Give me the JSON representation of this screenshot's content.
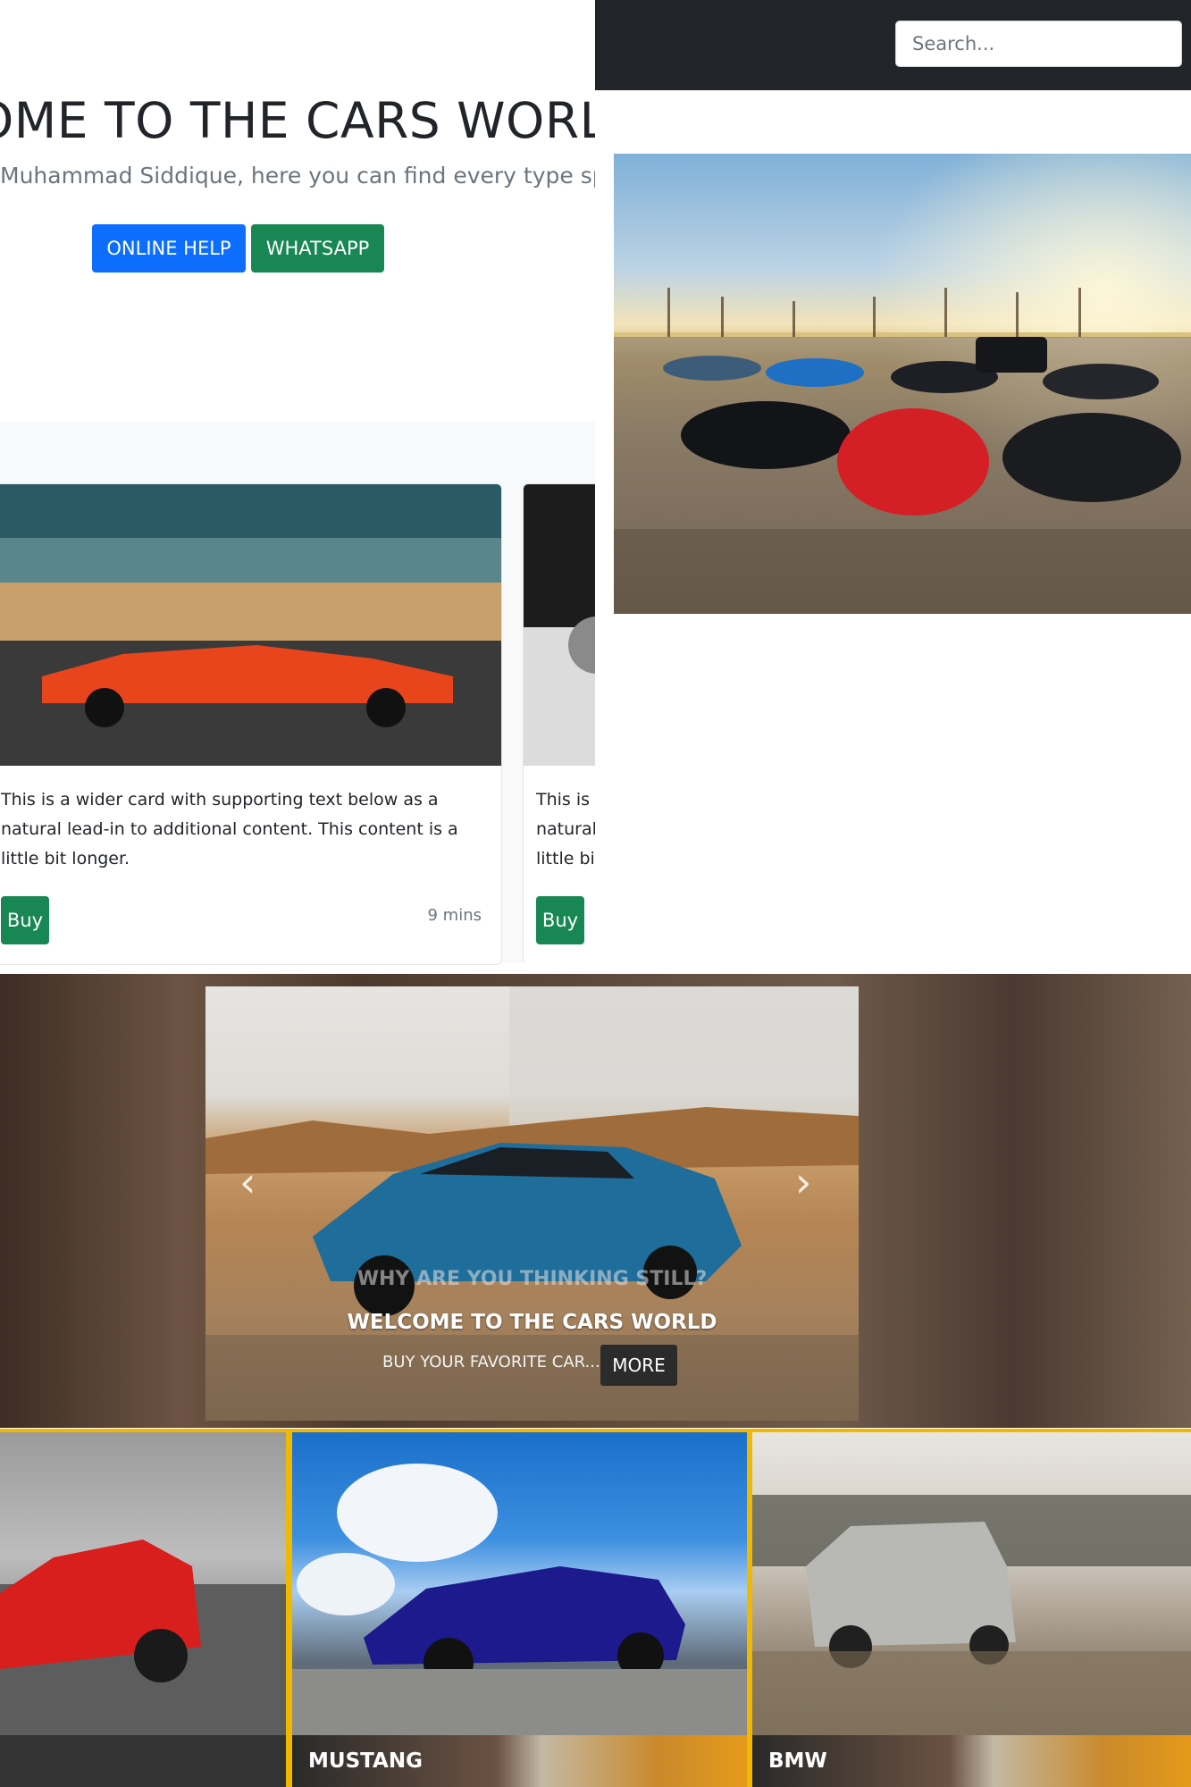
{
  "search": {
    "placeholder": "Search..."
  },
  "hero": {
    "title": "OME TO THE CARS WORLD",
    "subtitle": "Muhammad Siddique, here you can find every type sport",
    "online_help": "ONLINE HELP",
    "whatsapp": "WHATSAPP"
  },
  "cards": [
    {
      "text": "This is a wider card with supporting text below as a natural lead-in to additional content. This content is a little bit longer.",
      "buy": "Buy",
      "time": "9 mins"
    },
    {
      "text": "This is a wider card with supporting text below as a natural lead-in to additional content. This content is a little bit longer.",
      "buy": "Buy",
      "time": ""
    }
  ],
  "carousel": {
    "tagline": "WHY ARE YOU THINKING STILL?",
    "title": "WELCOME TO THE CARS WORLD",
    "subtitle": "BUY YOUR FAVORITE CAR.....",
    "more": "MORE",
    "prev_icon": "chevron-left-icon",
    "next_icon": "chevron-right-icon"
  },
  "gallery": [
    {
      "label": ""
    },
    {
      "label": "MUSTANG"
    },
    {
      "label": "BMW"
    }
  ],
  "colors": {
    "navbar": "#212529",
    "primary": "#0d6efd",
    "success": "#198754",
    "gallery_border": "#f0b800"
  }
}
